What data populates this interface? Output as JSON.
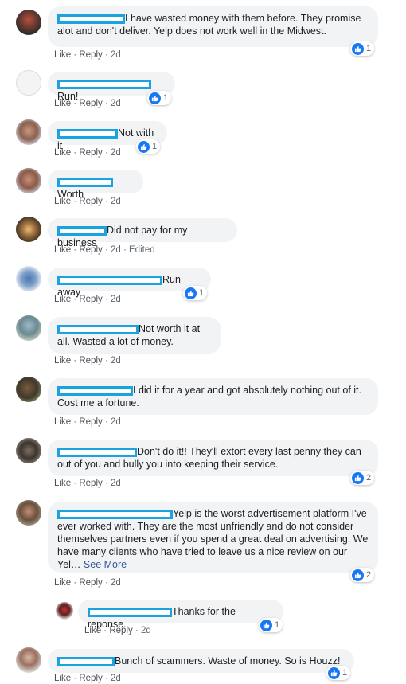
{
  "actions": {
    "like": "Like",
    "reply": "Reply",
    "sep": " · "
  },
  "comments": [
    {
      "text": "I have wasted money with them before. They promise alot and don't deliver. Yelp does not work well in the Midwest.",
      "time": "2d",
      "edited": "",
      "reactions": "1"
    },
    {
      "text": "Run!",
      "time": "2d",
      "edited": "",
      "reactions": "1"
    },
    {
      "text": "Not with it",
      "time": "2d",
      "edited": "",
      "reactions": "1"
    },
    {
      "text": "Worth",
      "time": "2d",
      "edited": "",
      "reactions": ""
    },
    {
      "text": "Did not pay for my business",
      "time": "2d",
      "edited": "Edited",
      "reactions": ""
    },
    {
      "text": "Run away",
      "time": "2d",
      "edited": "",
      "reactions": "1"
    },
    {
      "text": "Not worth it at all. Wasted a lot of money.",
      "time": "2d",
      "edited": "",
      "reactions": ""
    },
    {
      "text": "I did it for a year and got absolutely nothing out of it. Cost me a fortune.",
      "time": "2d",
      "edited": "",
      "reactions": ""
    },
    {
      "text": "Don't do it!! They'll extort every last penny they can out of you and bully you into keeping their service.",
      "time": "2d",
      "edited": "",
      "reactions": "2"
    },
    {
      "text": "Yelp is the worst advertisement platform I've ever worked with. They are the most unfriendly and do not consider themselves partners even if you spend a great deal on advertising. We have many clients who have tried to leave us a nice review on our Yel…",
      "see_more": "See More",
      "time": "2d",
      "edited": "",
      "reactions": "2"
    },
    {
      "text": "Thanks for the reponse.",
      "time": "2d",
      "edited": "",
      "reactions": "1"
    },
    {
      "text": "Bunch of scammers. Waste of money. So is Houzz!",
      "time": "2d",
      "edited": "",
      "reactions": "1"
    }
  ]
}
